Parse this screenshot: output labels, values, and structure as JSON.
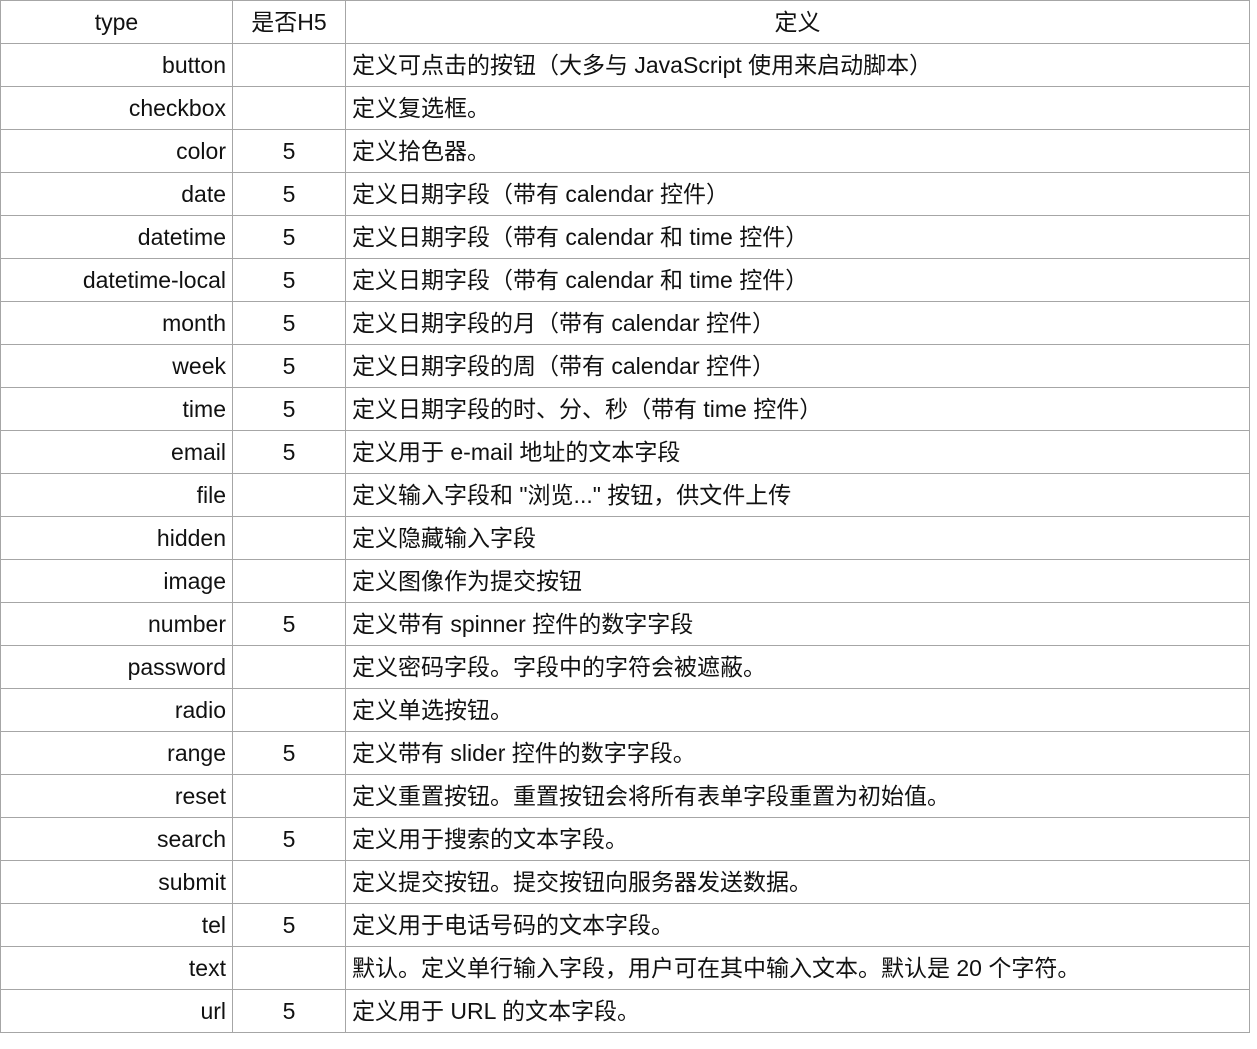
{
  "table": {
    "headers": {
      "type": "type",
      "h5": "是否H5",
      "definition": "定义"
    },
    "rows": [
      {
        "type": "button",
        "h5": "",
        "definition": "定义可点击的按钮（大多与 JavaScript 使用来启动脚本）"
      },
      {
        "type": "checkbox",
        "h5": "",
        "definition": "定义复选框。"
      },
      {
        "type": "color",
        "h5": "5",
        "definition": "定义拾色器。"
      },
      {
        "type": "date",
        "h5": "5",
        "definition": "定义日期字段（带有 calendar 控件）"
      },
      {
        "type": "datetime",
        "h5": "5",
        "definition": "定义日期字段（带有 calendar 和 time 控件）"
      },
      {
        "type": "datetime-local",
        "h5": "5",
        "definition": "定义日期字段（带有 calendar 和 time 控件）"
      },
      {
        "type": "month",
        "h5": "5",
        "definition": "定义日期字段的月（带有 calendar 控件）"
      },
      {
        "type": "week",
        "h5": "5",
        "definition": "定义日期字段的周（带有 calendar 控件）"
      },
      {
        "type": "time",
        "h5": "5",
        "definition": "定义日期字段的时、分、秒（带有 time 控件）"
      },
      {
        "type": "email",
        "h5": "5",
        "definition": "定义用于 e-mail 地址的文本字段"
      },
      {
        "type": "file",
        "h5": "",
        "definition": "定义输入字段和 \"浏览...\" 按钮，供文件上传"
      },
      {
        "type": "hidden",
        "h5": "",
        "definition": "定义隐藏输入字段"
      },
      {
        "type": "image",
        "h5": "",
        "definition": "定义图像作为提交按钮"
      },
      {
        "type": "number",
        "h5": "5",
        "definition": "定义带有 spinner 控件的数字字段"
      },
      {
        "type": "password",
        "h5": "",
        "definition": "定义密码字段。字段中的字符会被遮蔽。"
      },
      {
        "type": "radio",
        "h5": "",
        "definition": "定义单选按钮。"
      },
      {
        "type": "range",
        "h5": "5",
        "definition": "定义带有 slider 控件的数字字段。"
      },
      {
        "type": "reset",
        "h5": "",
        "definition": "定义重置按钮。重置按钮会将所有表单字段重置为初始值。"
      },
      {
        "type": "search",
        "h5": "5",
        "definition": "定义用于搜索的文本字段。"
      },
      {
        "type": "submit",
        "h5": "",
        "definition": "定义提交按钮。提交按钮向服务器发送数据。"
      },
      {
        "type": "tel",
        "h5": "5",
        "definition": "定义用于电话号码的文本字段。"
      },
      {
        "type": "text",
        "h5": "",
        "definition": "默认。定义单行输入字段，用户可在其中输入文本。默认是 20 个字符。"
      },
      {
        "type": "url",
        "h5": "5",
        "definition": "定义用于 URL 的文本字段。"
      }
    ]
  },
  "colors": {
    "h5_marker": "#e8112d",
    "grid_line": "#a6a6a6",
    "text": "#111111",
    "background": "#ffffff"
  }
}
